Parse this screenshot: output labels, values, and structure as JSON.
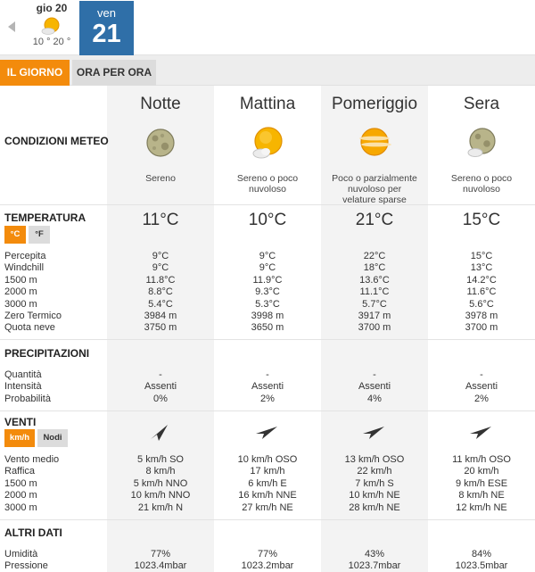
{
  "days": {
    "prev": {
      "name": "gio 20",
      "range": "10 ° 20 °",
      "icon": "sun-cloud-icon"
    },
    "current": {
      "name": "ven",
      "number": "21"
    }
  },
  "tabs": {
    "day": "IL GIORNO",
    "hourly": "ORA PER ORA"
  },
  "periods": [
    {
      "name": "Notte",
      "icon": "moon-icon",
      "desc": "Sereno"
    },
    {
      "name": "Mattina",
      "icon": "sun-cloud-icon",
      "desc": "Sereno o poco nuvoloso"
    },
    {
      "name": "Pomeriggio",
      "icon": "sun-haze-icon",
      "desc": "Poco o parzialmente nuvoloso per velature sparse"
    },
    {
      "name": "Sera",
      "icon": "moon-cloud-icon",
      "desc": "Sereno o poco nuvoloso"
    }
  ],
  "sections": {
    "conditions": "CONDIZIONI METEO",
    "temperature": "TEMPERATURA",
    "precipitation": "PRECIPITAZIONI",
    "wind": "VENTI",
    "other": "ALTRI DATI"
  },
  "units": {
    "temp": [
      "°C",
      "°F"
    ],
    "wind": [
      "km/h",
      "Nodi"
    ]
  },
  "temperature": {
    "main": [
      "11°C",
      "10°C",
      "21°C",
      "15°C"
    ],
    "labels": [
      "Percepita",
      "Windchill",
      "1500 m",
      "2000 m",
      "3000 m",
      "Zero Termico",
      "Quota neve"
    ],
    "rows": [
      [
        "9°C",
        "9°C",
        "22°C",
        "15°C"
      ],
      [
        "9°C",
        "9°C",
        "18°C",
        "13°C"
      ],
      [
        "11.8°C",
        "11.9°C",
        "13.6°C",
        "14.2°C"
      ],
      [
        "8.8°C",
        "9.3°C",
        "11.1°C",
        "11.6°C"
      ],
      [
        "5.4°C",
        "5.3°C",
        "5.7°C",
        "5.6°C"
      ],
      [
        "3984 m",
        "3998 m",
        "3917 m",
        "3978 m"
      ],
      [
        "3750 m",
        "3650 m",
        "3700 m",
        "3700 m"
      ]
    ]
  },
  "precipitation": {
    "labels": [
      "Quantità",
      "Intensità",
      "Probabilità"
    ],
    "rows": [
      [
        "-",
        "-",
        "-",
        "-"
      ],
      [
        "Assenti",
        "Assenti",
        "Assenti",
        "Assenti"
      ],
      [
        "0%",
        "2%",
        "4%",
        "2%"
      ]
    ]
  },
  "wind": {
    "arrow_directions": [
      "SO",
      "OSO",
      "OSO",
      "OSO"
    ],
    "labels": [
      "Vento medio",
      "Raffica",
      "1500 m",
      "2000 m",
      "3000 m"
    ],
    "rows": [
      [
        "5 km/h  SO",
        "10 km/h OSO",
        "13 km/h OSO",
        "11 km/h OSO"
      ],
      [
        "8 km/h",
        "17 km/h",
        "22 km/h",
        "20 km/h"
      ],
      [
        "5 km/h NNO",
        "6 km/h E",
        "7 km/h S",
        "9 km/h ESE"
      ],
      [
        "10 km/h NNO",
        "16 km/h NNE",
        "10 km/h NE",
        "8 km/h NE"
      ],
      [
        "21 km/h N",
        "27 km/h NE",
        "28 km/h NE",
        "12 km/h NE"
      ]
    ]
  },
  "other": {
    "labels": [
      "Umidità",
      "Pressione"
    ],
    "rows": [
      [
        "77%",
        "77%",
        "43%",
        "84%"
      ],
      [
        "1023.4mbar",
        "1023.2mbar",
        "1023.7mbar",
        "1023.5mbar"
      ]
    ]
  },
  "colors": {
    "accent": "#f38b0c",
    "current_day": "#2f6fa8",
    "tab_bg": "#ededed",
    "column_shade": "#f3f3f3"
  }
}
